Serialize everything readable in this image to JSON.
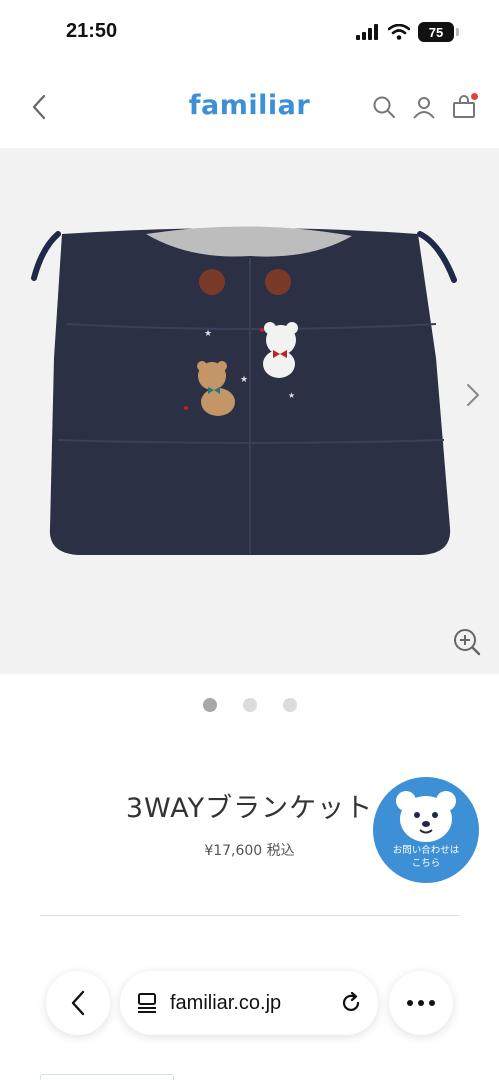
{
  "status": {
    "time": "21:50",
    "battery": "75"
  },
  "header": {
    "brand": "familiar",
    "icons": [
      "back-icon",
      "search-icon",
      "user-icon",
      "cart-icon"
    ]
  },
  "gallery": {
    "image_count": 3,
    "active_index": 0
  },
  "product": {
    "title": "3WAYブランケット",
    "price": "¥17,600",
    "tax_label": "税込"
  },
  "contact": {
    "line1": "お問い合わせは",
    "line2": "こちら"
  },
  "browser": {
    "url": "familiar.co.jp"
  },
  "colors": {
    "brand": "#3d8fd6",
    "cart_badge": "#e0413a",
    "product_navy": "#2b3045"
  }
}
